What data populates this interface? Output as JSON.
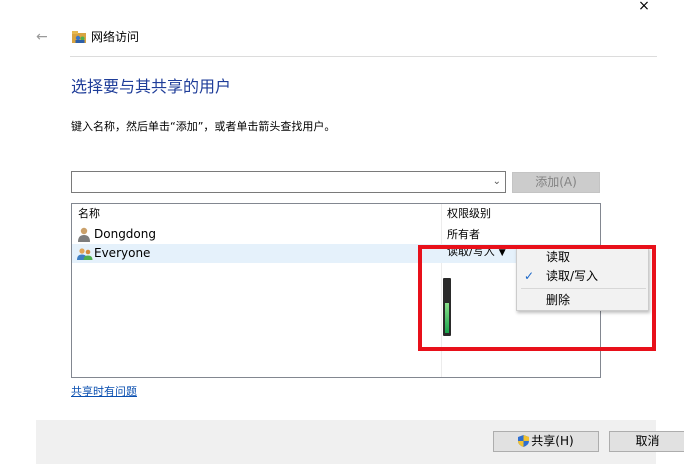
{
  "window": {
    "title": "网络访问",
    "close_label": "×",
    "back_label": "←"
  },
  "heading": "选择要与其共享的用户",
  "instruction": "键入名称，然后单击“添加”，或者单击箭头查找用户。",
  "combo": {
    "value": "",
    "arrow": "⌄"
  },
  "add_button": "添加(A)",
  "list": {
    "columns": {
      "name": "名称",
      "permission": "权限级别"
    },
    "rows": [
      {
        "name": "Dongdong",
        "permission": "所有者"
      },
      {
        "name": "Everyone",
        "permission": "读取/写入",
        "arrow": "▼"
      }
    ]
  },
  "menu": {
    "items": [
      {
        "label": "读取"
      },
      {
        "label": "读取/写入",
        "checked": true
      },
      {
        "label": "删除"
      }
    ],
    "check_mark": "✓"
  },
  "help_link": "共享时有问题",
  "footer": {
    "share_button": "共享(H)",
    "cancel_button": "取消"
  },
  "colors": {
    "heading": "#1f3d99",
    "link": "#0a4fb0",
    "highlight": "#e8101a",
    "selected_row": "#e5f1fb"
  }
}
